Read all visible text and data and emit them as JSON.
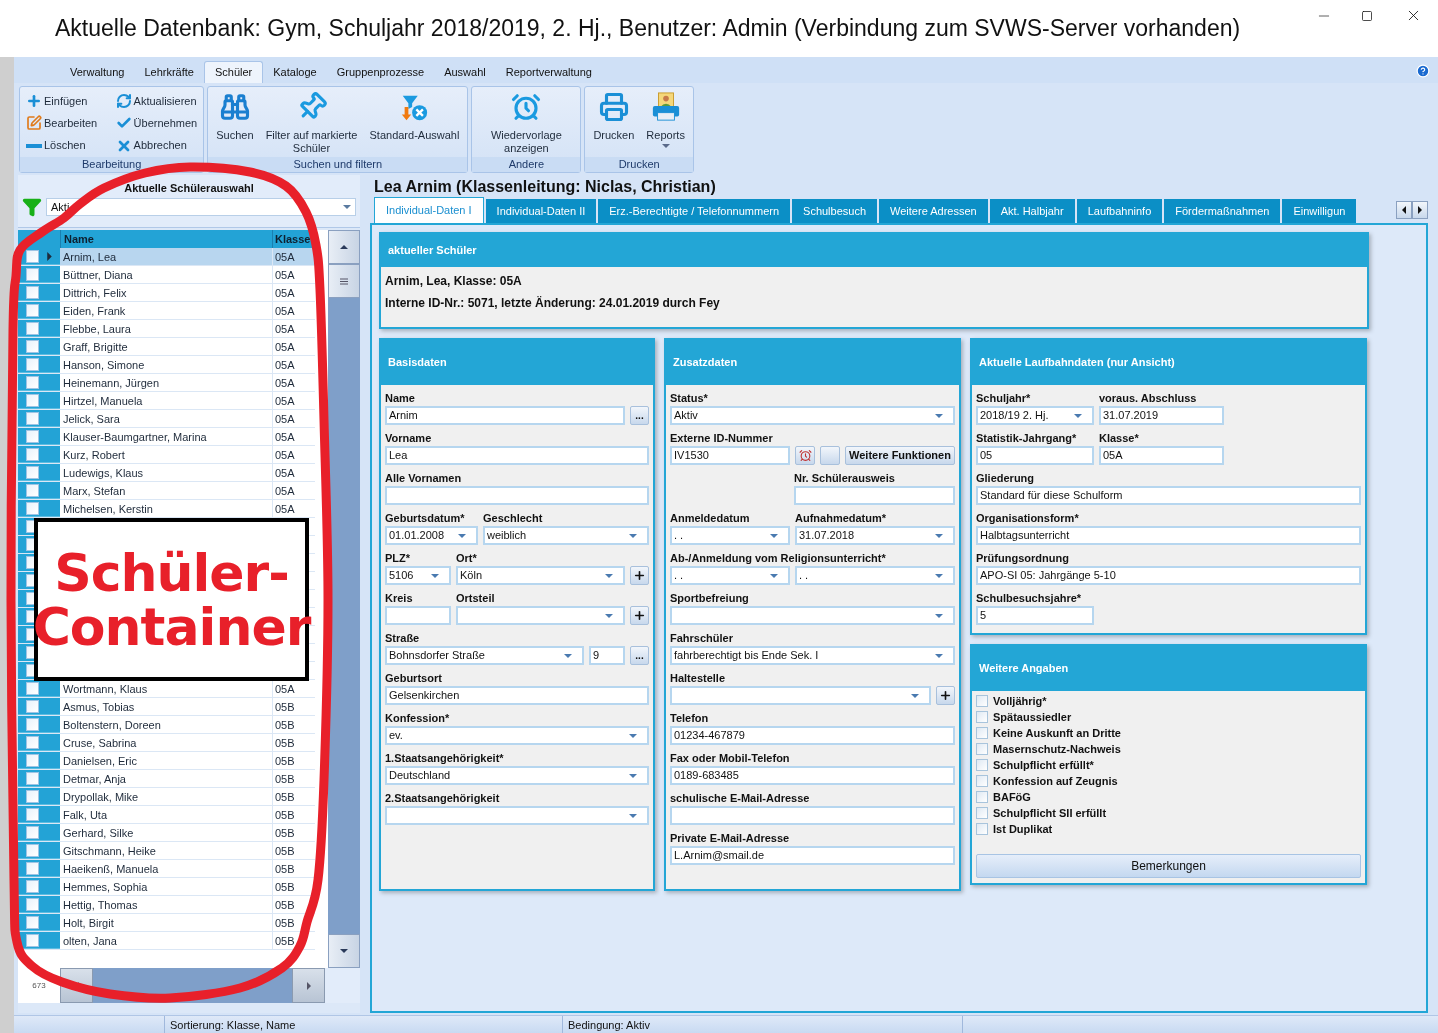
{
  "window": {
    "title": "Aktuelle Datenbank: Gym, Schuljahr 2018/2019, 2. Hj., Benutzer: Admin (Verbindung zum SVWS-Server vorhanden)"
  },
  "ribbon_tabs": [
    {
      "label": "Verwaltung",
      "selected": false
    },
    {
      "label": "Lehrkräfte",
      "selected": false
    },
    {
      "label": "Schüler",
      "selected": true
    },
    {
      "label": "Kataloge",
      "selected": false
    },
    {
      "label": "Gruppenprozesse",
      "selected": false
    },
    {
      "label": "Auswahl",
      "selected": false
    },
    {
      "label": "Reportverwaltung",
      "selected": false
    }
  ],
  "ribbon_groups": [
    {
      "title": "Bearbeitung",
      "kind": "small",
      "buttons": [
        {
          "label": "Einfügen"
        },
        {
          "label": "Aktualisieren"
        },
        {
          "label": "Bearbeiten"
        },
        {
          "label": "Übernehmen"
        },
        {
          "label": "Löschen"
        },
        {
          "label": "Abbrechen"
        }
      ]
    },
    {
      "title": "Suchen und filtern",
      "kind": "large",
      "buttons": [
        {
          "label": "Suchen"
        },
        {
          "label": "Filter auf markierte Schüler"
        },
        {
          "label": "Standard-Auswahl"
        }
      ]
    },
    {
      "title": "Andere",
      "kind": "large",
      "buttons": [
        {
          "label": "Wiedervorlage anzeigen"
        }
      ]
    },
    {
      "title": "Drucken",
      "kind": "large",
      "buttons": [
        {
          "label": "Drucken",
          "dropdown": false
        },
        {
          "label": "Reports",
          "dropdown": true
        }
      ]
    }
  ],
  "student_panel": {
    "title": "Aktuelle Schülerauswahl",
    "filter_value": "Akti",
    "columns": [
      "Name",
      "Klasse"
    ],
    "rows_top": [
      {
        "name": "Arnim, Lea",
        "class": "05A",
        "checked": false,
        "selected": true
      },
      {
        "name": "Büttner, Diana",
        "class": "05A",
        "checked": false,
        "selected": false
      },
      {
        "name": "Dittrich, Felix",
        "class": "05A",
        "checked": false,
        "selected": false
      },
      {
        "name": "Eiden, Frank",
        "class": "05A",
        "checked": false,
        "selected": false
      },
      {
        "name": "Flebbe, Laura",
        "class": "05A",
        "checked": false,
        "selected": false
      },
      {
        "name": "Graff, Brigitte",
        "class": "05A",
        "checked": false,
        "selected": false
      },
      {
        "name": "Hanson, Simone",
        "class": "05A",
        "checked": false,
        "selected": false
      },
      {
        "name": "Heinemann, Jürgen",
        "class": "05A",
        "checked": false,
        "selected": false
      },
      {
        "name": "Hirtzel, Manuela",
        "class": "05A",
        "checked": false,
        "selected": false
      },
      {
        "name": "Jelick, Sara",
        "class": "05A",
        "checked": false,
        "selected": false
      },
      {
        "name": "Klauser-Baumgartner, Marina",
        "class": "05A",
        "checked": false,
        "selected": false
      },
      {
        "name": "Kurz, Robert",
        "class": "05A",
        "checked": false,
        "selected": false
      },
      {
        "name": "Ludewigs, Klaus",
        "class": "05A",
        "checked": false,
        "selected": false
      },
      {
        "name": "Marx, Stefan",
        "class": "05A",
        "checked": false,
        "selected": false
      },
      {
        "name": "Michelsen, Kerstin",
        "class": "05A",
        "checked": false,
        "selected": false
      }
    ],
    "rows_covered": [
      {
        "checked": false
      },
      {
        "checked": false
      },
      {
        "checked": false
      },
      {
        "checked": false
      },
      {
        "checked": false
      },
      {
        "checked": false
      },
      {
        "checked": false
      },
      {
        "checked": false
      },
      {
        "checked": false
      }
    ],
    "rows_bottom": [
      {
        "name": "Wortmann, Klaus",
        "class": "05A",
        "checked": false,
        "selected": false
      },
      {
        "name": "Asmus, Tobias",
        "class": "05B",
        "checked": false,
        "selected": false
      },
      {
        "name": "Boltenstern, Doreen",
        "class": "05B",
        "checked": false,
        "selected": false
      },
      {
        "name": "Cruse, Sabrina",
        "class": "05B",
        "checked": false,
        "selected": false
      },
      {
        "name": "Danielsen, Eric",
        "class": "05B",
        "checked": false,
        "selected": false
      },
      {
        "name": "Detmar, Anja",
        "class": "05B",
        "checked": false,
        "selected": false
      },
      {
        "name": "Drypollak, Mike",
        "class": "05B",
        "checked": false,
        "selected": false
      },
      {
        "name": "Falk, Uta",
        "class": "05B",
        "checked": false,
        "selected": false
      },
      {
        "name": "Gerhard, Silke",
        "class": "05B",
        "checked": false,
        "selected": false
      },
      {
        "name": "Gitschmann, Heike",
        "class": "05B",
        "checked": false,
        "selected": false
      },
      {
        "name": "Haeikenß, Manuela",
        "class": "05B",
        "checked": false,
        "selected": false
      },
      {
        "name": "Hemmes, Sophia",
        "class": "05B",
        "checked": false,
        "selected": false
      },
      {
        "name": "Hettig, Thomas",
        "class": "05B",
        "checked": false,
        "selected": false
      },
      {
        "name": "Holt, Birgit",
        "class": "05B",
        "checked": false,
        "selected": false
      },
      {
        "name": "olten, Jana",
        "class": "05B",
        "checked": false,
        "selected": false
      }
    ],
    "count": "673"
  },
  "annotation": {
    "label": "Schüler-Container"
  },
  "detail": {
    "title": "Lea Arnim (Klassenleitung: Niclas, Christian)",
    "tabs": [
      {
        "label": "Individual-Daten I",
        "selected": true
      },
      {
        "label": "Individual-Daten II",
        "selected": false
      },
      {
        "label": "Erz.-Berechtigte / Telefonnummern",
        "selected": false
      },
      {
        "label": "Schulbesuch",
        "selected": false
      },
      {
        "label": "Weitere Adressen",
        "selected": false
      },
      {
        "label": "Akt. Halbjahr",
        "selected": false
      },
      {
        "label": "Laufbahninfo",
        "selected": false
      },
      {
        "label": "Fördermaßnahmen",
        "selected": false
      },
      {
        "label": "Einwilligun",
        "selected": false
      }
    ],
    "current": {
      "title": "aktueller Schüler",
      "lines": [
        "Arnim, Lea, Klasse: 05A",
        "Interne ID-Nr.: 5071, letzte Änderung: 24.01.2019 durch Fey"
      ]
    },
    "basis": {
      "title": "Basisdaten",
      "rows": [
        {
          "items": [
            {
              "label": "Name",
              "value": "Arnim",
              "kind": "text"
            },
            {
              "value": "...",
              "kind": "dots"
            }
          ]
        },
        {
          "items": [
            {
              "label": "Vorname",
              "value": "Lea",
              "kind": "text"
            }
          ]
        },
        {
          "items": [
            {
              "label": "Alle Vornamen",
              "kind": "text"
            }
          ]
        },
        {
          "items": [
            {
              "label": "Geburtsdatum*",
              "value": "01.01.2008",
              "kind": "combo"
            },
            {
              "label": "Geschlecht",
              "value": "weiblich",
              "kind": "combo"
            }
          ]
        },
        {
          "items": [
            {
              "label": "PLZ*",
              "value": "5106",
              "kind": "combo"
            },
            {
              "label": "Ort*",
              "value": "Köln",
              "kind": "combo"
            },
            {
              "kind": "plus"
            }
          ]
        },
        {
          "items": [
            {
              "label": "Kreis",
              "kind": "text"
            },
            {
              "label": "Ortsteil",
              "kind": "combo"
            },
            {
              "kind": "plus"
            }
          ]
        },
        {
          "items": [
            {
              "label": "Straße",
              "value": "Bohnsdorfer Straße",
              "kind": "combo"
            },
            {
              "value": "9",
              "kind": "text"
            },
            {
              "value": "...",
              "kind": "dots"
            }
          ]
        },
        {
          "items": [
            {
              "label": "Geburtsort",
              "value": "Gelsenkirchen",
              "kind": "text"
            }
          ]
        },
        {
          "items": [
            {
              "label": "Konfession*",
              "value": "ev.",
              "kind": "combo"
            }
          ]
        },
        {
          "items": [
            {
              "label": "1.Staatsangehörigkeit*",
              "value": "Deutschland",
              "kind": "combo"
            }
          ]
        },
        {
          "items": [
            {
              "label": "2.Staatsangehörigkeit",
              "kind": "combo"
            }
          ]
        }
      ]
    },
    "extra": {
      "title": "Zusatzdaten",
      "rows": [
        {
          "items": [
            {
              "label": "Status*",
              "value": "Aktiv",
              "kind": "combo"
            }
          ]
        },
        {
          "items": [
            {
              "label": "Externe ID-Nummer",
              "value": "IV1530",
              "kind": "text"
            },
            {
              "kind": "clock"
            },
            {
              "kind": "blank"
            },
            {
              "value": "Weitere Funktionen",
              "kind": "button"
            }
          ]
        },
        {
          "items": [
            {
              "label": "Nr. Schülerausweis",
              "kind": "text"
            }
          ]
        },
        {
          "items": [
            {
              "label": "Anmeldedatum",
              "value": ". .",
              "kind": "combo"
            },
            {
              "label": "Aufnahmedatum*",
              "value": "31.07.2018",
              "kind": "combo"
            }
          ]
        },
        {
          "label": "Ab-/Anmeldung vom Religionsunterricht*",
          "items": [
            {
              "value": ". .",
              "kind": "combo"
            },
            {
              "value": ". .",
              "kind": "combo"
            }
          ]
        },
        {
          "items": [
            {
              "label": "Sportbefreiung",
              "kind": "combo"
            }
          ]
        },
        {
          "items": [
            {
              "label": "Fahrschüler",
              "value": "fahrberechtigt bis Ende Sek. I",
              "kind": "combo"
            }
          ]
        },
        {
          "items": [
            {
              "label": "Haltestelle",
              "kind": "combo"
            },
            {
              "kind": "plus"
            }
          ]
        },
        {
          "items": [
            {
              "label": "Telefon",
              "value": "01234-467879",
              "kind": "text"
            }
          ]
        },
        {
          "items": [
            {
              "label": "Fax oder Mobil-Telefon",
              "value": "0189-683485",
              "kind": "text"
            }
          ]
        },
        {
          "items": [
            {
              "label": "schulische E-Mail-Adresse",
              "kind": "text"
            }
          ]
        },
        {
          "items": [
            {
              "label": "Private E-Mail-Adresse",
              "value": "L.Arnim@smail.de",
              "kind": "text"
            }
          ]
        }
      ]
    },
    "career": {
      "title": "Aktuelle Laufbahndaten (nur Ansicht)",
      "rows": [
        {
          "items": [
            {
              "label": "Schuljahr*",
              "value": "2018/19 2. Hj.",
              "kind": "combo"
            },
            {
              "label": "voraus. Abschluss",
              "value": "31.07.2019",
              "kind": "text"
            }
          ]
        },
        {
          "items": [
            {
              "label": "Statistik-Jahrgang*",
              "value": "05",
              "kind": "text"
            },
            {
              "label": "Klasse*",
              "value": "05A",
              "kind": "text"
            }
          ]
        },
        {
          "items": [
            {
              "label": "Gliederung",
              "value": "Standard für diese Schulform",
              "kind": "text"
            }
          ]
        },
        {
          "items": [
            {
              "label": "Organisationsform*",
              "value": "Halbtagsunterricht",
              "kind": "text"
            }
          ]
        },
        {
          "items": [
            {
              "label": "Prüfungsordnung",
              "value": "APO-SI 05: Jahrgänge 5-10",
              "kind": "text"
            }
          ]
        },
        {
          "items": [
            {
              "label": "Schulbesuchsjahre*",
              "value": "5",
              "kind": "text"
            }
          ]
        }
      ]
    },
    "more": {
      "title": "Weitere Angaben",
      "checkboxes": [
        {
          "label": "Volljährig*",
          "checked": false
        },
        {
          "label": "Spätaussiedler",
          "checked": false
        },
        {
          "label": "Keine Auskunft an Dritte",
          "checked": false
        },
        {
          "label": "Masernschutz-Nachweis",
          "checked": false
        },
        {
          "label": "Schulpflicht erfüllt*",
          "checked": false
        },
        {
          "label": "Konfession auf Zeugnis",
          "checked": false
        },
        {
          "label": "BAFöG",
          "checked": false
        },
        {
          "label": "Schulpflicht SII erfüllt",
          "checked": false
        },
        {
          "label": "Ist Duplikat",
          "checked": false
        }
      ],
      "button": "Bemerkungen"
    }
  },
  "status_bar": [
    "Sortierung: Klasse, Name",
    "Bedingung: Aktiv"
  ]
}
